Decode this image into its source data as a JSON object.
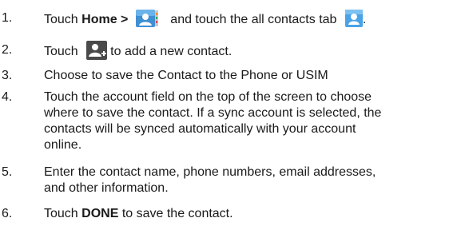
{
  "steps": [
    {
      "number": "1.",
      "text_before": "Touch ",
      "bold": "Home >",
      "text_after": " and touch the all contacts tab",
      "text_end": ".",
      "icons": [
        "contacts-app-icon",
        "all-contacts-tab-icon"
      ]
    },
    {
      "number": "2.",
      "text_before": "Touch",
      "text_after": "to add a new contact.",
      "icons": [
        "add-contact-icon"
      ]
    },
    {
      "number": "3.",
      "text": "Choose to save the Contact to the Phone or USIM"
    },
    {
      "number": "4.",
      "lines": [
        "Touch the account field on the top of the screen to choose",
        "where to save the contact. If a sync account is selected, the",
        "contacts will be synced automatically with your account",
        "online."
      ]
    },
    {
      "number": "5.",
      "lines": [
        "Enter the contact name, phone numbers, email addresses,",
        "and other information."
      ]
    },
    {
      "number": "6.",
      "text_before": "Touch ",
      "bold": "DONE",
      "text_after": " to save the contact."
    }
  ],
  "colors": {
    "text": "#1a1a1a",
    "icon_blue": "#2f8fd8",
    "icon_green": "#3aa55a",
    "icon_gray": "#5a5a5a"
  }
}
